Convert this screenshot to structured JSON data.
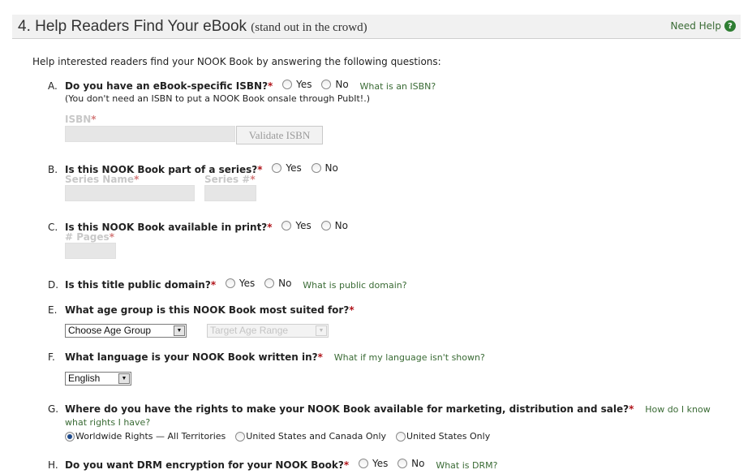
{
  "header": {
    "title": "4. Help Readers Find Your eBook",
    "subtitle": "(stand out in the crowd)",
    "help_label": "Need Help",
    "help_icon": "?"
  },
  "intro": "Help interested readers find your NOOK Book by answering the following questions:",
  "required_mark": "*",
  "questions": {
    "a": {
      "letter": "A.",
      "text": "Do you have an eBook-specific ISBN?",
      "yes": "Yes",
      "no": "No",
      "link": "What is an ISBN?",
      "note": "(You don't need an ISBN to put a NOOK Book onsale through PubIt!.)",
      "isbn_label": "ISBN",
      "validate_button": "Validate ISBN"
    },
    "b": {
      "letter": "B.",
      "text": "Is this NOOK Book part of a series?",
      "yes": "Yes",
      "no": "No",
      "series_name_label": "Series Name",
      "series_num_label": "Series #"
    },
    "c": {
      "letter": "C.",
      "text": "Is this NOOK Book available in print?",
      "yes": "Yes",
      "no": "No",
      "pages_label": "# Pages"
    },
    "d": {
      "letter": "D.",
      "text": "Is this title public domain?",
      "yes": "Yes",
      "no": "No",
      "link": "What is public domain?"
    },
    "e": {
      "letter": "E.",
      "text": "What age group is this NOOK Book most suited for?",
      "age_group_value": "Choose Age Group",
      "target_age_value": "Target Age Range"
    },
    "f": {
      "letter": "F.",
      "text": "What language is your NOOK Book written in?",
      "link": "What if my language isn't shown?",
      "language_value": "English"
    },
    "g": {
      "letter": "G.",
      "text": "Where do you have the rights to make your NOOK Book available for marketing, distribution and sale?",
      "link_part1": "How do I know",
      "link_part2": "what rights I have?",
      "options": [
        "Worldwide Rights — All Territories",
        "United States and Canada Only",
        "United States Only"
      ],
      "selected_option": "Worldwide Rights — All Territories"
    },
    "h": {
      "letter": "H.",
      "text": "Do you want DRM encryption for your NOOK Book?",
      "yes": "Yes",
      "no": "No",
      "link": "What is DRM?"
    }
  },
  "colors": {
    "required": "#b0141a",
    "link": "#3a6b35",
    "header_bg": "#f1f1f1",
    "disabled_field": "#e6e6e6"
  }
}
